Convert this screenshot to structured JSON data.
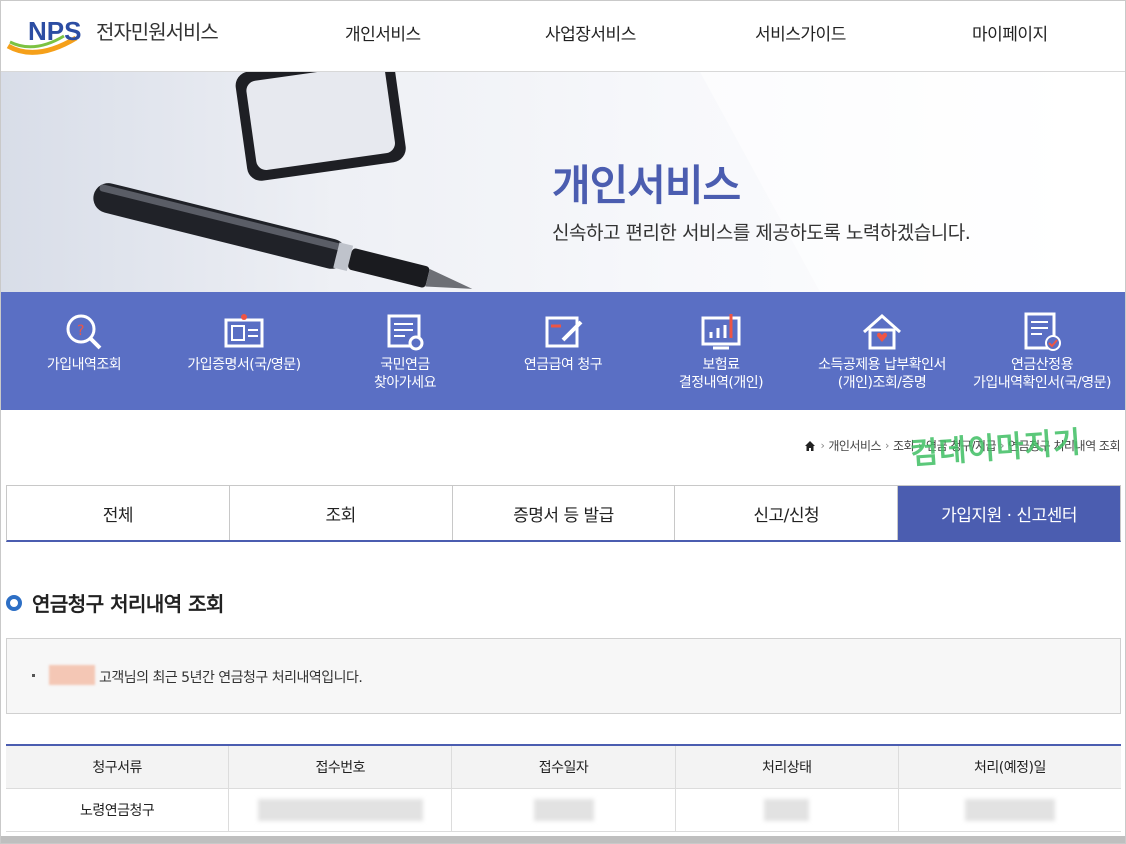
{
  "header": {
    "logo_mark": "NPS",
    "logo_text": "전자민원서비스",
    "nav": [
      "개인서비스",
      "사업장서비스",
      "서비스가이드",
      "마이페이지"
    ]
  },
  "banner": {
    "title": "개인서비스",
    "subtitle": "신속하고 편리한 서비스를 제공하도록 노력하겠습니다."
  },
  "quick_menu": [
    {
      "label": "가입내역조회",
      "icon": "search-question-icon"
    },
    {
      "label": "가입증명서(국/영문)",
      "icon": "id-card-icon"
    },
    {
      "label": "국민연금\n찾아가세요",
      "icon": "document-search-icon"
    },
    {
      "label": "연금급여 청구",
      "icon": "document-pen-icon"
    },
    {
      "label": "보험료\n결정내역(개인)",
      "icon": "chart-monitor-icon"
    },
    {
      "label": "소득공제용 납부확인서\n(개인)조회/증명",
      "icon": "house-heart-icon"
    },
    {
      "label": "연금산정용\n가입내역확인서(국/영문)",
      "icon": "document-check-icon"
    }
  ],
  "breadcrumb": [
    "개인서비스",
    "조회",
    "연금 청구/지급",
    "연금청구 처리내역 조회"
  ],
  "watermark": "컴데이마지기",
  "tabs": [
    "전체",
    "조회",
    "증명서 등 발급",
    "신고/신청",
    "가입지원 · 신고센터"
  ],
  "section_title": "연금청구 처리내역 조회",
  "info_text": "고객님의 최근 5년간 연금청구 처리내역입니다.",
  "table": {
    "headers": [
      "청구서류",
      "접수번호",
      "접수일자",
      "처리상태",
      "처리(예정)일"
    ],
    "rows": [
      [
        "노령연금청구"
      ]
    ]
  },
  "colors": {
    "primary": "#4b5db0",
    "quick_bg": "#5a6fc4",
    "bullet": "#2d6fc5",
    "watermark": "#3fbf63"
  }
}
